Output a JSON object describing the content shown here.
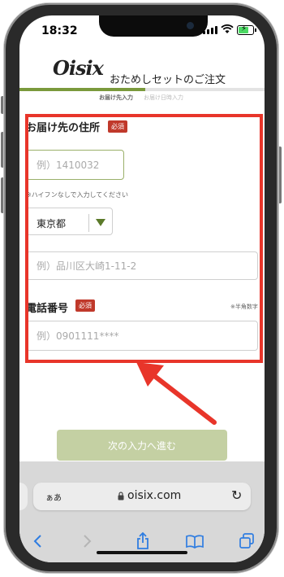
{
  "status_bar": {
    "time": "18:32"
  },
  "header": {
    "logo": "Oisix",
    "title": "おためしセットのご注文"
  },
  "progress": {
    "steps": [
      "お届け先入力",
      "お届け日時入力"
    ],
    "active_step": 1
  },
  "form": {
    "address_label": "お届け先の住所",
    "required_badge": "必須",
    "postal_placeholder": "例）1410032",
    "postal_hint": "※ハイフンなしで入力してください",
    "prefecture_value": "東京都",
    "address_placeholder": "例）品川区大崎1-11-2",
    "phone_label": "電話番号",
    "phone_required_badge": "必須",
    "phone_note": "※半角数字",
    "phone_placeholder": "例）0901111****"
  },
  "next_button": "次の入力へ進む",
  "browser": {
    "aa": "ぁあ",
    "url": "oisix.com"
  },
  "colors": {
    "accent": "#7a9a3c",
    "highlight": "#e8352a",
    "required": "#c0392b"
  }
}
